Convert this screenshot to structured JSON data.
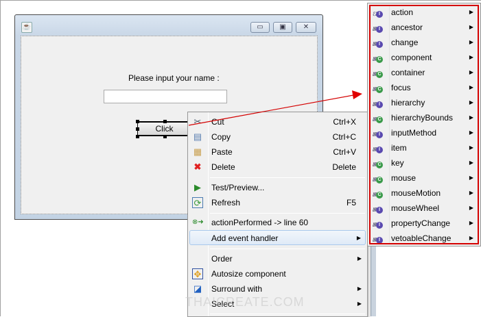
{
  "form": {
    "label": "Please input your name :",
    "name_value": "",
    "button_label": "Click",
    "window_buttons": {
      "minimize": "▭",
      "maximize": "▣",
      "close": "✕"
    }
  },
  "context_menu": {
    "items": [
      {
        "label": "Cut",
        "shortcut": "Ctrl+X",
        "icon": "scissors-icon"
      },
      {
        "label": "Copy",
        "shortcut": "Ctrl+C",
        "icon": "copy-icon"
      },
      {
        "label": "Paste",
        "shortcut": "Ctrl+V",
        "icon": "paste-icon"
      },
      {
        "label": "Delete",
        "shortcut": "Delete",
        "icon": "delete-icon"
      },
      {
        "label": "Test/Preview...",
        "shortcut": "",
        "icon": "preview-icon"
      },
      {
        "label": "Refresh",
        "shortcut": "F5",
        "icon": "refresh-icon"
      },
      {
        "label": "actionPerformed -> line 60",
        "shortcut": "",
        "icon": "event-link-icon"
      },
      {
        "label": "Add event handler",
        "submenu": true,
        "highlighted": true
      },
      {
        "label": "Order",
        "submenu": true
      },
      {
        "label": "Autosize component",
        "icon": "autosize-icon"
      },
      {
        "label": "Surround with",
        "submenu": true,
        "icon": "surround-icon"
      },
      {
        "label": "Select",
        "submenu": true
      }
    ]
  },
  "event_submenu": {
    "highlight_color": "#d40000",
    "items": [
      {
        "label": "action",
        "type": "I"
      },
      {
        "label": "ancestor",
        "type": "I"
      },
      {
        "label": "change",
        "type": "I"
      },
      {
        "label": "component",
        "type": "C"
      },
      {
        "label": "container",
        "type": "C"
      },
      {
        "label": "focus",
        "type": "C"
      },
      {
        "label": "hierarchy",
        "type": "I"
      },
      {
        "label": "hierarchyBounds",
        "type": "C"
      },
      {
        "label": "inputMethod",
        "type": "I"
      },
      {
        "label": "item",
        "type": "I"
      },
      {
        "label": "key",
        "type": "C"
      },
      {
        "label": "mouse",
        "type": "C"
      },
      {
        "label": "mouseMotion",
        "type": "C"
      },
      {
        "label": "mouseWheel",
        "type": "I"
      },
      {
        "label": "propertyChange",
        "type": "I"
      },
      {
        "label": "vetoableChange",
        "type": "I"
      }
    ]
  },
  "watermark": "THAICREATE.COM"
}
